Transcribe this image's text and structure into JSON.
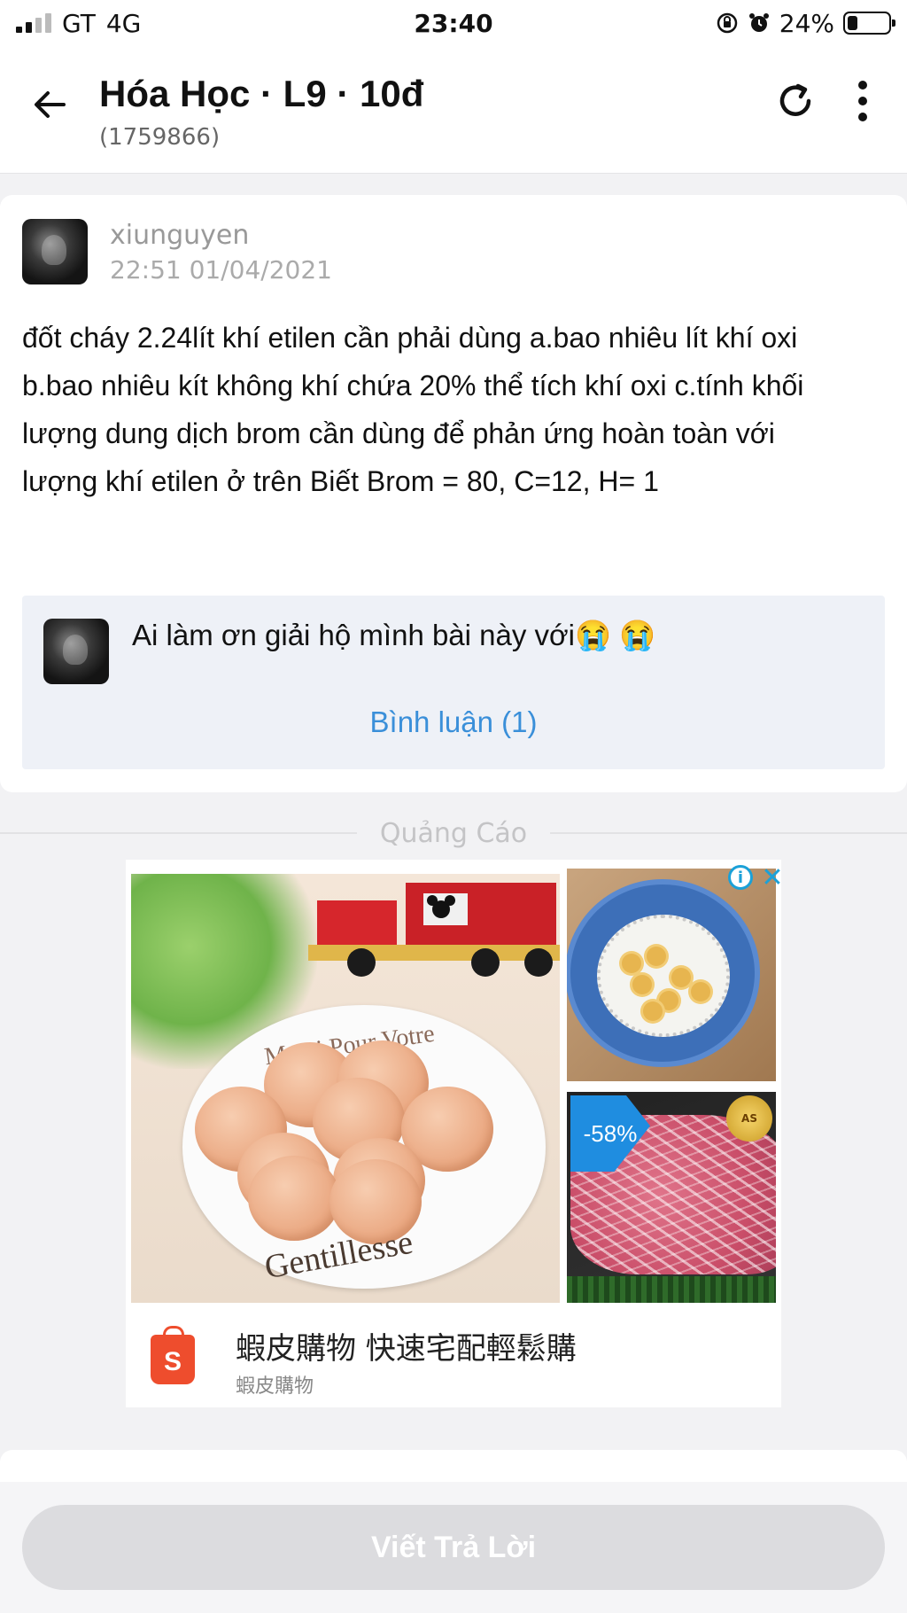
{
  "status_bar": {
    "carrier": "GT",
    "network": "4G",
    "time": "23:40",
    "battery": "24%",
    "battery_level": 0.24
  },
  "header": {
    "title": "Hóa Học · L9 · 10đ",
    "subtitle": "(1759866)"
  },
  "question": {
    "username": "xiunguyen",
    "timestamp": "22:51 01/04/2021",
    "text": "đốt cháy 2.24lít khí etilen cần phải dùng a.bao nhiêu lít khí oxi b.bao nhiêu kít không khí chứa 20% thể tích khí oxi c.tính khối lượng dung dịch brom cần dùng để phản ứng hoàn toàn với lượng khí etilen ở trên Biết Brom = 80, C=12, H= 1",
    "comment": {
      "text": "Ai làm ơn giải hộ mình bài này với😭 😭",
      "link": "Bình luận (1)"
    }
  },
  "ad": {
    "separator_label": "Quảng Cáo",
    "plate_text": "Gentillesse",
    "plate_text_top": "Merci Pour Votre",
    "discount": "-58%",
    "badge_text": "AS",
    "title": "蝦皮購物 快速宅配輕鬆購",
    "brand": "蝦皮購物",
    "logo_letter": "S",
    "info_symbol": "i",
    "close_symbol": "✕",
    "colors": {
      "accent": "#1ba1d8",
      "shopee": "#ee4d2d",
      "discount": "#1f8de0"
    }
  },
  "bottom": {
    "reply_label": "Viết Trả Lời"
  },
  "icons": {
    "back": "arrow-left-icon",
    "reload": "reload-icon",
    "more": "more-vertical-icon"
  }
}
